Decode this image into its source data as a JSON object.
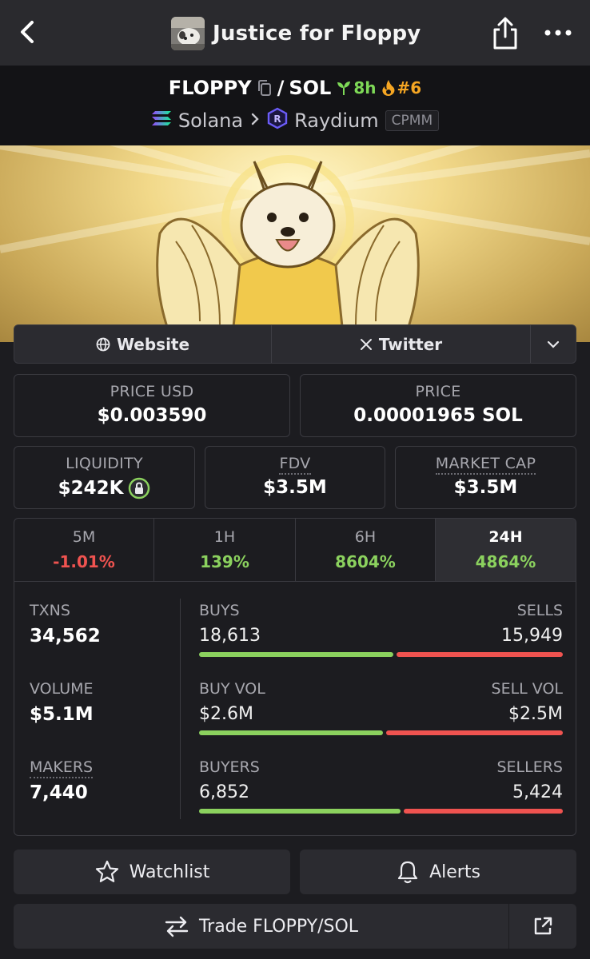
{
  "header": {
    "title": "Justice for Floppy",
    "icons": {
      "back": "chevron-left-icon",
      "share": "share-icon",
      "more": "more-icon"
    }
  },
  "pair": {
    "base": "FLOPPY",
    "separator": "/",
    "quote": "SOL",
    "age": "8h",
    "rank": "#6",
    "chain": "Solana",
    "dex": "Raydium",
    "pool_type": "CPMM"
  },
  "links": {
    "website": "Website",
    "twitter": "Twitter"
  },
  "stats": {
    "price_usd_label": "PRICE USD",
    "price_usd": "$0.003590",
    "price_label": "PRICE",
    "price": "0.00001965 SOL",
    "liquidity_label": "LIQUIDITY",
    "liquidity": "$242K",
    "fdv_label": "FDV",
    "fdv": "$3.5M",
    "mcap_label": "MARKET CAP",
    "mcap": "$3.5M"
  },
  "timeframes": [
    {
      "label": "5M",
      "change": "-1.01%"
    },
    {
      "label": "1H",
      "change": "139%"
    },
    {
      "label": "6H",
      "change": "8604%"
    },
    {
      "label": "24H",
      "change": "4864%"
    }
  ],
  "txns": {
    "txns_label": "TXNS",
    "txns": "34,562",
    "volume_label": "VOLUME",
    "volume": "$5.1M",
    "makers_label": "MAKERS",
    "makers": "7,440",
    "buys_label": "BUYS",
    "buys": "18,613",
    "sells_label": "SELLS",
    "sells": "15,949",
    "buy_vol_label": "BUY VOL",
    "buy_vol": "$2.6M",
    "sell_vol_label": "SELL VOL",
    "sell_vol": "$2.5M",
    "buyers_label": "BUYERS",
    "buyers": "6,852",
    "sellers_label": "SELLERS",
    "sellers": "5,424",
    "buy_share": 0.539,
    "buy_vol_share": 0.51,
    "buyer_share": 0.558
  },
  "actions": {
    "watchlist": "Watchlist",
    "alerts": "Alerts",
    "trade": "Trade FLOPPY/SOL"
  },
  "colors": {
    "green": "#8bd15e",
    "red": "#ef5350",
    "orange": "#f5a623"
  }
}
